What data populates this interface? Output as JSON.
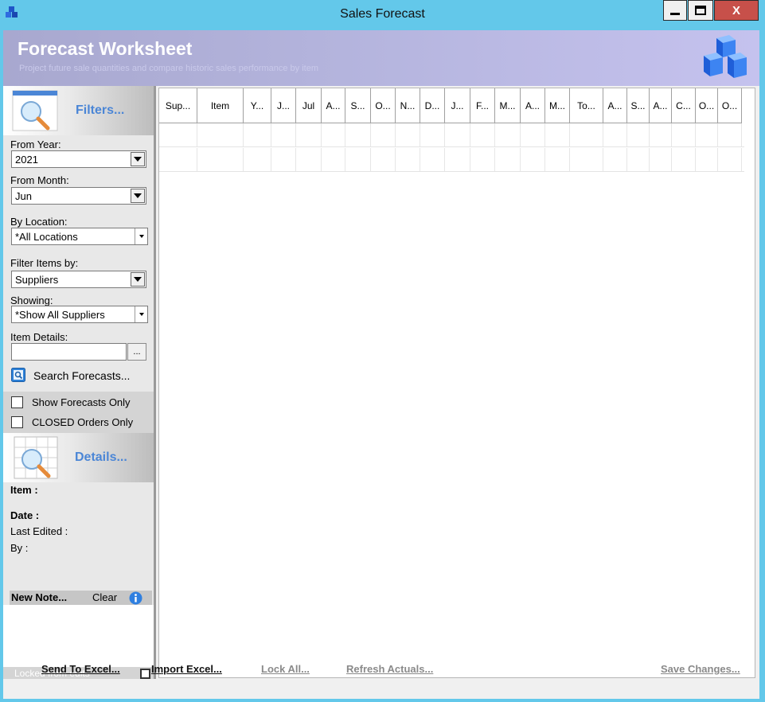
{
  "window": {
    "title": "Sales Forecast",
    "close_label": "X"
  },
  "header": {
    "title": "Forecast Worksheet",
    "subtitle": "Project future sale quantities and compare historic sales performance by item"
  },
  "filters": {
    "section_label": "Filters...",
    "from_year": {
      "label": "From Year:",
      "value": "2021"
    },
    "from_month": {
      "label": "From Month:",
      "value": "Jun"
    },
    "by_location": {
      "label": "By Location:",
      "value": "*All Locations"
    },
    "filter_items_by": {
      "label": "Filter Items by:",
      "value": "Suppliers"
    },
    "showing": {
      "label": "Showing:",
      "value": "*Show All Suppliers"
    },
    "item_details": {
      "label": "Item Details:",
      "value": "",
      "browse_label": "..."
    },
    "search_label": "Search Forecasts...",
    "show_forecasts_only": "Show Forecasts Only",
    "closed_orders_only": "CLOSED Orders Only"
  },
  "details": {
    "section_label": "Details...",
    "item_label": "Item :",
    "date_label": "Date :",
    "last_edited_label": "Last Edited :",
    "by_label": "By :",
    "new_note_label": "New Note...",
    "clear_label": "Clear",
    "locked_label": "Locked from edits"
  },
  "grid": {
    "columns": [
      "Sup...",
      "Item",
      "Y...",
      "J...",
      "Jul",
      "A...",
      "S...",
      "O...",
      "N...",
      "D...",
      "J...",
      "F...",
      "M...",
      "A...",
      "M...",
      "To...",
      "A...",
      "S...",
      "A...",
      "C...",
      "O...",
      "O..."
    ]
  },
  "footer": {
    "send_to_excel": "Send To Excel...",
    "import_excel": "Import Excel...",
    "lock_all": "Lock All...",
    "refresh_actuals": "Refresh Actuals...",
    "save_changes": "Save Changes..."
  },
  "icons": {
    "app": "cubes-icon",
    "header": "cubes-icon",
    "filters": "magnifier-icon",
    "details": "magnifier-grid-icon",
    "search": "search-forecast-icon",
    "info": "info-icon"
  },
  "colors": {
    "titlebar": "#63c8ea",
    "section_label": "#4b86d6",
    "header_gradient_start": "#a8a8cf",
    "header_gradient_end": "#c5c2ee",
    "close_button": "#c7504a"
  }
}
